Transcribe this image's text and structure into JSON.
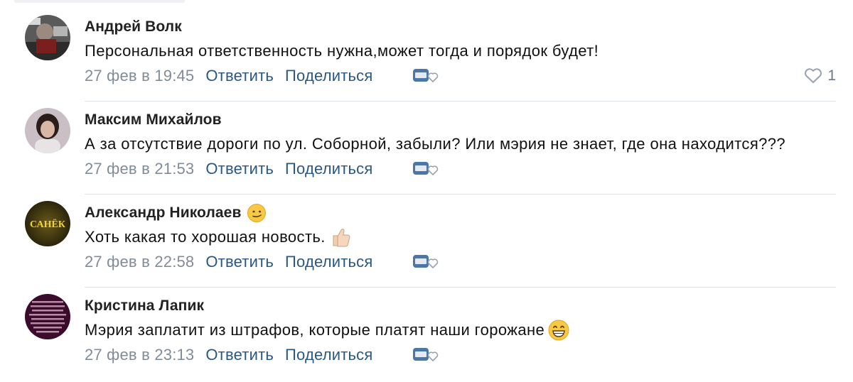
{
  "comments": [
    {
      "author": "Андрей Волк",
      "text": "Персональная ответственность нужна,может тогда и порядок будет!",
      "date": "27 фев в 19:45",
      "reply_label": "Ответить",
      "share_label": "Поделиться",
      "likes": "1",
      "avatar_icon": "user-photo-avatar"
    },
    {
      "author": "Максим Михайлов",
      "text": "А за отсутствие дороги по ул. Соборной, забыли? Или мэрия не знает, где она находится???",
      "date": "27 фев в 21:53",
      "reply_label": "Ответить",
      "share_label": "Поделиться",
      "avatar_icon": "user-photo-avatar"
    },
    {
      "author": "Александр Николаев",
      "author_emoji": "smirk-emoji",
      "text": "Хоть какая то хорошая новость.",
      "text_emoji": "thumbs-up-emoji",
      "date": "27 фев в 22:58",
      "reply_label": "Ответить",
      "share_label": "Поделиться",
      "avatar_label": "САНЁК"
    },
    {
      "author": "Кристина Лапик",
      "text": "Мэрия заплатит из штрафов, которые платят наши горожане",
      "text_emoji": "grinning-emoji",
      "date": "27 фев в 23:13",
      "reply_label": "Ответить",
      "share_label": "Поделиться",
      "avatar_icon": "text-collage-avatar"
    }
  ],
  "colors": {
    "link": "#2a5885",
    "date": "#818c99",
    "divider": "#dce1e6",
    "like_icon": "#99a2ad"
  }
}
